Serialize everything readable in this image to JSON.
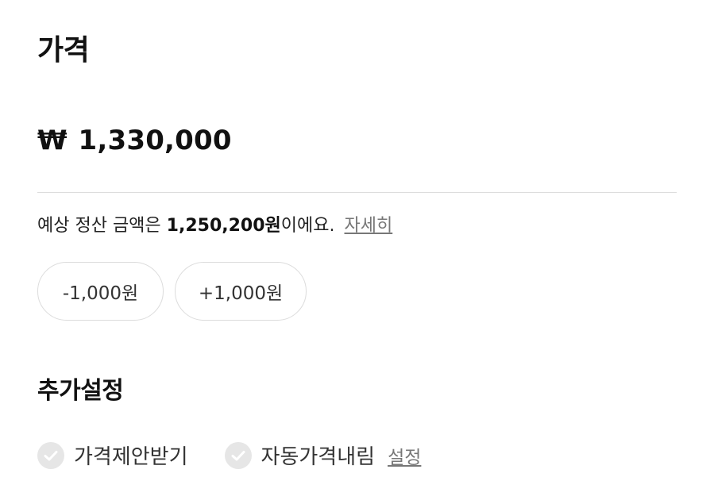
{
  "price_section": {
    "title": "가격",
    "currency_symbol": "₩",
    "price": "1,330,000"
  },
  "settlement": {
    "prefix": "예상 정산 금액은 ",
    "amount": "1,250,200원",
    "suffix": "이에요.",
    "detail_link": "자세히"
  },
  "adjust_buttons": {
    "minus": "-1,000원",
    "plus": "+1,000원"
  },
  "extra_settings": {
    "title": "추가설정",
    "option_offer": "가격제안받기",
    "option_auto_drop": "자동가격내림",
    "setting_link": "설정"
  },
  "icons": {
    "check": "check-circle-icon",
    "check_color": "#e6e6e6"
  }
}
